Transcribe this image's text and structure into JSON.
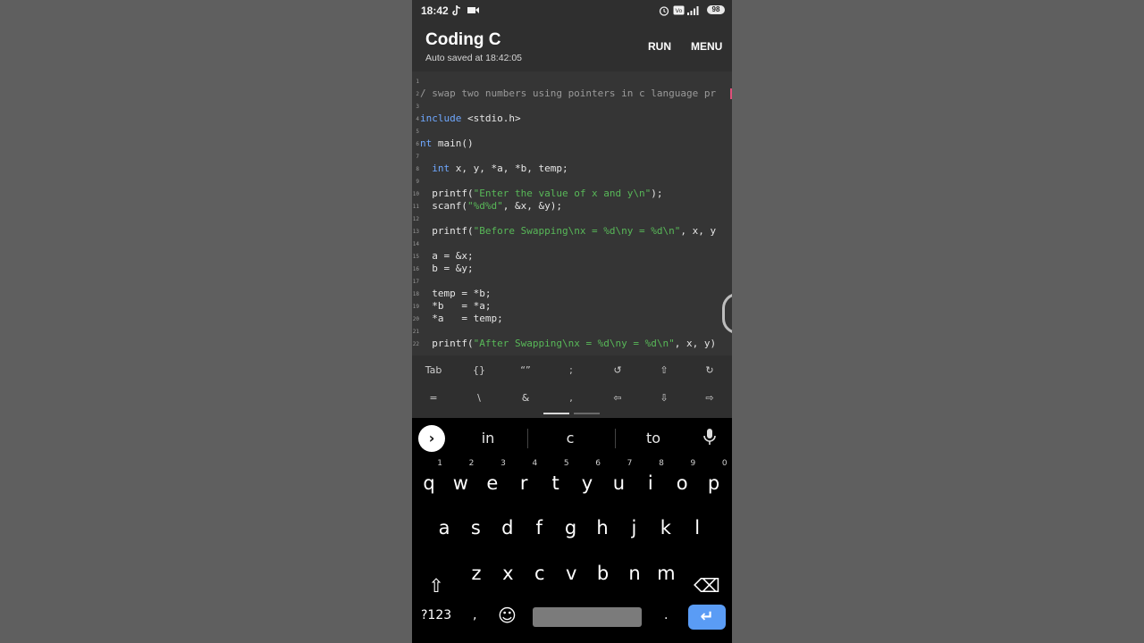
{
  "status_bar": {
    "time": "18:42",
    "battery": "98",
    "icons": [
      "tiktok-icon",
      "video-icon",
      "alarm-icon",
      "volte-icon",
      "signal-icon",
      "battery-icon"
    ]
  },
  "app_bar": {
    "title": "Coding C",
    "subtitle": "Auto saved at 18:42:05",
    "run_label": "RUN",
    "menu_label": "MENU"
  },
  "editor": {
    "lines": [
      {
        "n": "1",
        "text": ""
      },
      {
        "n": "2",
        "text": "/ swap two numbers using pointers in c language pr"
      },
      {
        "n": "3",
        "text": ""
      },
      {
        "n": "4",
        "text": "include <stdio.h>"
      },
      {
        "n": "5",
        "text": ""
      },
      {
        "n": "6",
        "text": "nt main()"
      },
      {
        "n": "7",
        "text": ""
      },
      {
        "n": "8",
        "text": "  int x, y, *a, *b, temp;"
      },
      {
        "n": "9",
        "text": ""
      },
      {
        "n": "10",
        "text": "  printf(\"Enter the value of x and y\\n\");"
      },
      {
        "n": "11",
        "text": "  scanf(\"%d%d\", &x, &y);"
      },
      {
        "n": "12",
        "text": ""
      },
      {
        "n": "13",
        "text": "  printf(\"Before Swapping\\nx = %d\\ny = %d\\n\", x, y"
      },
      {
        "n": "14",
        "text": ""
      },
      {
        "n": "15",
        "text": "  a = &x;"
      },
      {
        "n": "16",
        "text": "  b = &y;"
      },
      {
        "n": "17",
        "text": ""
      },
      {
        "n": "18",
        "text": "  temp = *b;"
      },
      {
        "n": "19",
        "text": "  *b   = *a;"
      },
      {
        "n": "20",
        "text": "  *a   = temp;"
      },
      {
        "n": "21",
        "text": ""
      },
      {
        "n": "22",
        "text": "  printf(\"After Swapping\\nx = %d\\ny = %d\\n\", x, y)"
      }
    ]
  },
  "extra_keys": {
    "row1": [
      "Tab",
      "{}",
      "“”",
      ";",
      "↺",
      "⇧",
      "↻"
    ],
    "row2": [
      "=",
      "\\",
      "&",
      ",",
      "⇦",
      "⇩",
      "⇨"
    ]
  },
  "keyboard": {
    "suggestions": [
      "in",
      "c",
      "to"
    ],
    "row1": [
      {
        "k": "q",
        "h": "1"
      },
      {
        "k": "w",
        "h": "2"
      },
      {
        "k": "e",
        "h": "3"
      },
      {
        "k": "r",
        "h": "4"
      },
      {
        "k": "t",
        "h": "5"
      },
      {
        "k": "y",
        "h": "6"
      },
      {
        "k": "u",
        "h": "7"
      },
      {
        "k": "i",
        "h": "8"
      },
      {
        "k": "o",
        "h": "9"
      },
      {
        "k": "p",
        "h": "0"
      }
    ],
    "row2": [
      "a",
      "s",
      "d",
      "f",
      "g",
      "h",
      "j",
      "k",
      "l"
    ],
    "row3": [
      "z",
      "x",
      "c",
      "v",
      "b",
      "n",
      "m"
    ],
    "shift": "⇧",
    "backspace": "⌫",
    "numbers_label": "?123",
    "comma": ",",
    "emoji": "☺",
    "period": ".",
    "enter": "↵"
  },
  "colors": {
    "keyword": "#6fa8ff",
    "string": "#58b858",
    "comment": "#9a9a9a",
    "enter_key": "#5a9cf5"
  }
}
